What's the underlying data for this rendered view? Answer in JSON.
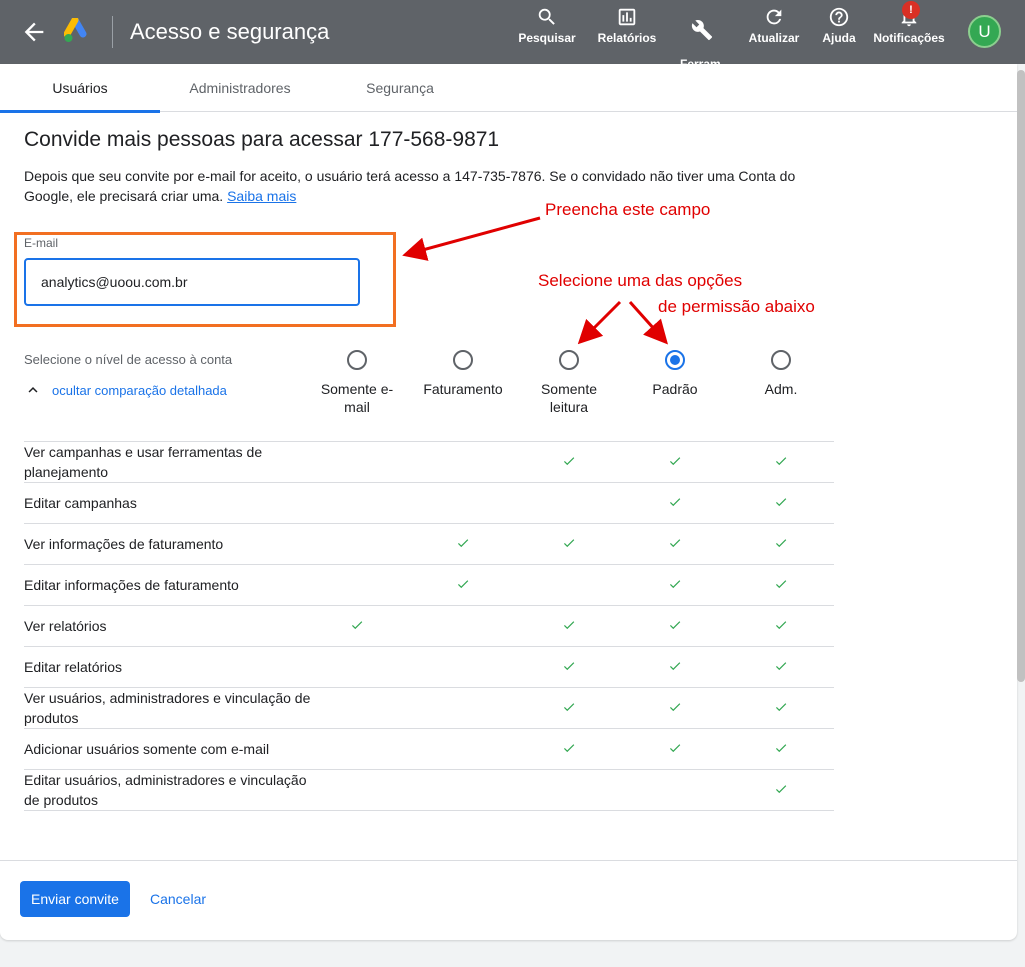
{
  "header": {
    "title": "Acesso e segurança",
    "actions": [
      {
        "label": "Pesquisar",
        "icon": "search-icon"
      },
      {
        "label": "Relatórios",
        "icon": "reports-icon"
      },
      {
        "label": "Ferram.\ne",
        "icon": "wrench-icon"
      },
      {
        "label": "Atualizar",
        "icon": "refresh-icon"
      },
      {
        "label": "Ajuda",
        "icon": "help-icon"
      },
      {
        "label": "Notificações",
        "icon": "bell-icon",
        "badge": "!"
      }
    ],
    "avatar_letter": "U"
  },
  "tabs": [
    {
      "label": "Usuários",
      "active": true
    },
    {
      "label": "Administradores",
      "active": false
    },
    {
      "label": "Segurança",
      "active": false
    }
  ],
  "main": {
    "heading": "Convide mais pessoas para acessar 177-568-9871",
    "description": "Depois que seu convite por e-mail for aceito, o usuário terá acesso a 147-735-7876. Se o convidado não tiver uma Conta do Google, ele precisará criar uma.",
    "learn_more": "Saiba mais",
    "email": {
      "label": "E-mail",
      "value": "analytics@uoou.com.br"
    },
    "access_level_label": "Selecione o nível de acesso à conta",
    "toggle_detail_label": "ocultar comparação detalhada",
    "access_levels": [
      {
        "label": "Somente e-\nmail",
        "selected": false
      },
      {
        "label": "Faturamento",
        "selected": false
      },
      {
        "label": "Somente\nleitura",
        "selected": false
      },
      {
        "label": "Padrão",
        "selected": true
      },
      {
        "label": "Adm.",
        "selected": false
      }
    ],
    "permissions": [
      {
        "label": "Ver campanhas e usar ferramentas de planejamento",
        "checks": [
          false,
          false,
          true,
          true,
          true
        ]
      },
      {
        "label": "Editar campanhas",
        "checks": [
          false,
          false,
          false,
          true,
          true
        ]
      },
      {
        "label": "Ver informações de faturamento",
        "checks": [
          false,
          true,
          true,
          true,
          true
        ]
      },
      {
        "label": "Editar informações de faturamento",
        "checks": [
          false,
          true,
          false,
          true,
          true
        ]
      },
      {
        "label": "Ver relatórios",
        "checks": [
          true,
          false,
          true,
          true,
          true
        ]
      },
      {
        "label": "Editar relatórios",
        "checks": [
          false,
          false,
          true,
          true,
          true
        ]
      },
      {
        "label": "Ver usuários, administradores e vinculação de produtos",
        "checks": [
          false,
          false,
          true,
          true,
          true
        ]
      },
      {
        "label": "Adicionar usuários somente com e-mail",
        "checks": [
          false,
          false,
          true,
          true,
          true
        ]
      },
      {
        "label": "Editar usuários, administradores e vinculação de produtos",
        "checks": [
          false,
          false,
          false,
          false,
          true
        ]
      }
    ]
  },
  "annotations": {
    "fill_field": "Preencha este campo",
    "select_line1": "Selecione uma das opções",
    "select_line2": "de permissão abaixo",
    "color": "#e00000"
  },
  "footer": {
    "send_label": "Enviar convite",
    "cancel_label": "Cancelar"
  },
  "colors": {
    "header_bg": "#5f6368",
    "accent": "#1a73e8",
    "check": "#34a853",
    "highlight_box": "#f26f21"
  }
}
